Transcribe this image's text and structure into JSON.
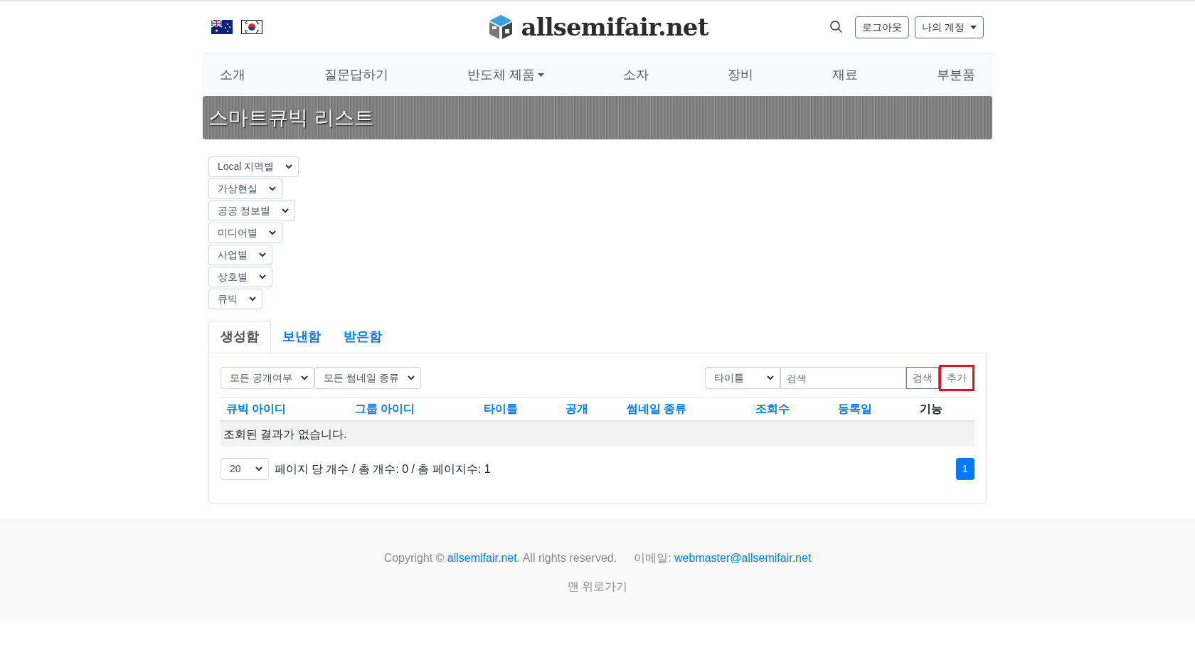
{
  "header": {
    "flags": [
      {
        "kind": "australia"
      },
      {
        "kind": "korea"
      }
    ],
    "logo_text": "allsemifair.net",
    "buttons": [
      {
        "label": "로그아웃",
        "dropdown": false
      },
      {
        "label": "나의 계정",
        "dropdown": true
      }
    ]
  },
  "nav": [
    {
      "label": "소개",
      "dropdown": false
    },
    {
      "label": "질문답하기",
      "dropdown": false
    },
    {
      "label": "반도체 제품",
      "dropdown": true
    },
    {
      "label": "소자",
      "dropdown": false
    },
    {
      "label": "장비",
      "dropdown": false
    },
    {
      "label": "재료",
      "dropdown": false
    },
    {
      "label": "부분품",
      "dropdown": false
    }
  ],
  "banner": {
    "title": "스마트큐빅 리스트"
  },
  "filters": [
    {
      "value": "Local 지역별"
    },
    {
      "value": "가상현실"
    },
    {
      "value": "공공 정보별"
    },
    {
      "value": "미디어별"
    },
    {
      "value": "사업별"
    },
    {
      "value": "상호별"
    },
    {
      "value": "큐빅"
    }
  ],
  "tabs": [
    {
      "label": "생성함",
      "selected": true
    },
    {
      "label": "보낸함",
      "selected": false
    },
    {
      "label": "받은함",
      "selected": false
    }
  ],
  "toolbar": {
    "selects": [
      "모든 공개여부",
      "모든 썸네일 종류"
    ],
    "search_field_select": "타이틀",
    "search": {
      "placeholder": "검색"
    },
    "search_button": "검색",
    "add_button": {
      "label": "추가",
      "highlighted": true
    }
  },
  "table": {
    "columns": [
      {
        "label": "큐빅 아이디",
        "kind": "sortable"
      },
      {
        "label": "그룹 아이디",
        "kind": "sortable"
      },
      {
        "label": "타이틀",
        "kind": "sortable"
      },
      {
        "label": "공개",
        "kind": "sortable"
      },
      {
        "label": "썸네일 종류",
        "kind": "sortable"
      },
      {
        "label": "조회수",
        "kind": "sortable"
      },
      {
        "label": "등록일",
        "kind": "sortable"
      },
      {
        "label": "기능",
        "kind": "plain"
      }
    ],
    "empty_message": "조회된 결과가 없습니다."
  },
  "pagination": {
    "page_size": "20",
    "summary": "페이지 당 개수 / 총 개수: 0 / 총 페이지수: 1",
    "pages": [
      {
        "label": "1",
        "selected": true
      }
    ]
  },
  "footer": {
    "copyright_prefix": "Copyright © ",
    "site_link": "allsemifair.net",
    "copyright_suffix": ". All rights reserved.",
    "email_label": "이메일: ",
    "email": "webmaster@allsemifair.net",
    "back_to_top": "맨 위로가기"
  }
}
